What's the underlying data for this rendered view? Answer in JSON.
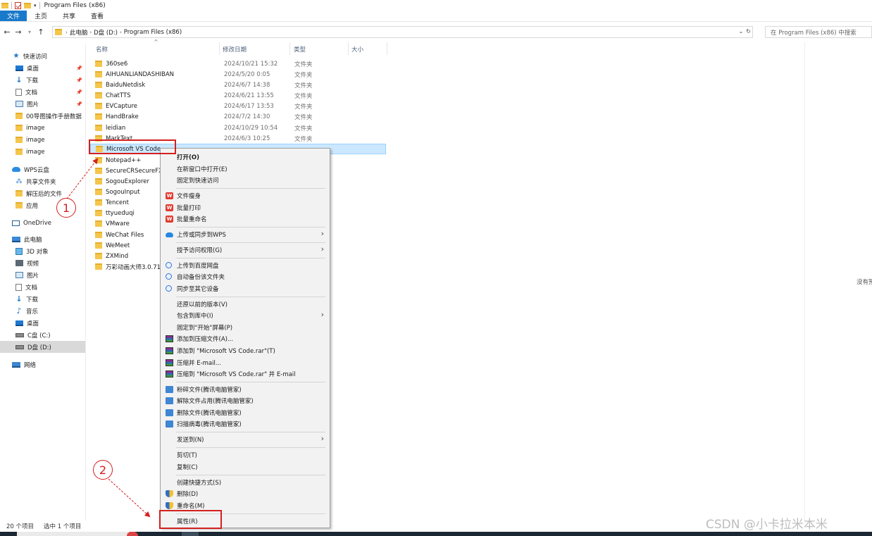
{
  "window": {
    "title": "Program Files (x86)"
  },
  "ribbon": {
    "tabs": [
      "文件",
      "主页",
      "共享",
      "查看"
    ]
  },
  "address": {
    "crumbs": [
      "此电脑",
      "D盘 (D:)",
      "Program Files (x86)"
    ],
    "search_placeholder": "在 Program Files (x86) 中搜索"
  },
  "sidebar": {
    "quick_access": "快速访问",
    "items_quick": [
      {
        "label": "桌面",
        "icon": "desktop-icon"
      },
      {
        "label": "下载",
        "icon": "download-icon"
      },
      {
        "label": "文档",
        "icon": "document-icon"
      },
      {
        "label": "图片",
        "icon": "picture-icon"
      },
      {
        "label": "00导图操作手册数据",
        "icon": "folder-icon"
      },
      {
        "label": "image",
        "icon": "folder-icon"
      },
      {
        "label": "image",
        "icon": "folder-icon"
      },
      {
        "label": "image",
        "icon": "folder-icon"
      }
    ],
    "wps": "WPS云盘",
    "items_wps": [
      {
        "label": "共享文件夹",
        "icon": "share-icon"
      },
      {
        "label": "解压后的文件",
        "icon": "folder-icon"
      },
      {
        "label": "应用",
        "icon": "folder-icon"
      }
    ],
    "onedrive": "OneDrive",
    "this_pc": "此电脑",
    "items_pc": [
      {
        "label": "3D 对象",
        "icon": "cube-icon"
      },
      {
        "label": "视频",
        "icon": "video-icon"
      },
      {
        "label": "图片",
        "icon": "picture-icon"
      },
      {
        "label": "文档",
        "icon": "document-icon"
      },
      {
        "label": "下载",
        "icon": "download-icon"
      },
      {
        "label": "音乐",
        "icon": "music-icon"
      },
      {
        "label": "桌面",
        "icon": "desktop-icon"
      },
      {
        "label": "C盘 (C:)",
        "icon": "drive-icon"
      },
      {
        "label": "D盘 (D:)",
        "icon": "drive-icon"
      }
    ],
    "network": "网络"
  },
  "columns": {
    "name": "名称",
    "date": "修改日期",
    "type": "类型",
    "size": "大小"
  },
  "files": [
    {
      "name": "360se6",
      "date": "2024/10/21 15:32",
      "type": "文件夹"
    },
    {
      "name": "AIHUANLIANDASHIBAN",
      "date": "2024/5/20 0:05",
      "type": "文件夹"
    },
    {
      "name": "BaiduNetdisk",
      "date": "2024/6/7 14:38",
      "type": "文件夹"
    },
    {
      "name": "ChatTTS",
      "date": "2024/6/21 13:55",
      "type": "文件夹"
    },
    {
      "name": "EVCapture",
      "date": "2024/6/17 13:53",
      "type": "文件夹"
    },
    {
      "name": "HandBrake",
      "date": "2024/7/2 14:30",
      "type": "文件夹"
    },
    {
      "name": "leidian",
      "date": "2024/10/29 10:54",
      "type": "文件夹"
    },
    {
      "name": "MarkText",
      "date": "2024/6/3 10:25",
      "type": "文件夹"
    },
    {
      "name": "Microsoft VS Code",
      "date": "",
      "type": ""
    },
    {
      "name": "Notepad++",
      "date": "",
      "type": ""
    },
    {
      "name": "SecureCRSecureFX",
      "date": "",
      "type": ""
    },
    {
      "name": "SogouExplorer",
      "date": "",
      "type": ""
    },
    {
      "name": "SogouInput",
      "date": "",
      "type": ""
    },
    {
      "name": "Tencent",
      "date": "",
      "type": ""
    },
    {
      "name": "ttyueduqi",
      "date": "",
      "type": ""
    },
    {
      "name": "VMware",
      "date": "",
      "type": ""
    },
    {
      "name": "WeChat Files",
      "date": "",
      "type": ""
    },
    {
      "name": "WeMeet",
      "date": "",
      "type": ""
    },
    {
      "name": "ZXMind",
      "date": "",
      "type": ""
    },
    {
      "name": "万彩动画大师3.0.716",
      "date": "",
      "type": ""
    }
  ],
  "status": {
    "count": "20 个项目",
    "selected": "选中 1 个项目"
  },
  "preview": {
    "none": "没有预"
  },
  "context_menu": {
    "open": "打开(O)",
    "open_new_window": "在新窗口中打开(E)",
    "pin_quick": "固定到快速访问",
    "wps_slim": "文件瘦身",
    "wps_print": "批量打印",
    "wps_rename": "批量重命名",
    "wps_upload": "上传或同步到WPS",
    "grant_access": "授予访问权限(G)",
    "baidu_upload": "上传到百度网盘",
    "baidu_backup": "自动备份该文件夹",
    "baidu_sync": "同步至其它设备",
    "restore": "还原以前的版本(V)",
    "include_library": "包含到库中(I)",
    "pin_start": "固定到\"开始\"屏幕(P)",
    "rar_add": "添加到压缩文件(A)...",
    "rar_add_named": "添加到 \"Microsoft VS Code.rar\"(T)",
    "rar_email": "压缩并 E-mail...",
    "rar_email_named": "压缩到 \"Microsoft VS Code.rar\" 并 E-mail",
    "tx_shred": "粉碎文件(腾讯电脑管家)",
    "tx_unlock": "解除文件占用(腾讯电脑管家)",
    "tx_delete": "删除文件(腾讯电脑管家)",
    "tx_scan": "扫描病毒(腾讯电脑管家)",
    "send_to": "发送到(N)",
    "cut": "剪切(T)",
    "copy": "复制(C)",
    "shortcut": "创建快捷方式(S)",
    "delete": "删除(D)",
    "rename": "重命名(M)",
    "properties": "属性(R)"
  },
  "annotations": {
    "step1": "1",
    "step2": "2",
    "accent": "#d42020"
  },
  "watermark": "CSDN @小卡拉米本米"
}
